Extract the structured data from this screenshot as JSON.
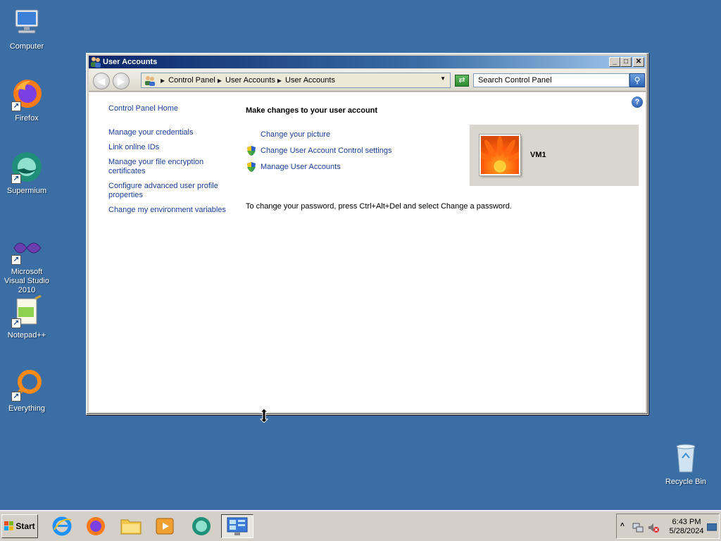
{
  "desktop": {
    "icons": [
      {
        "label": "Computer"
      },
      {
        "label": "Firefox"
      },
      {
        "label": "Supermium"
      },
      {
        "label": "Microsoft Visual Studio 2010"
      },
      {
        "label": "Notepad++"
      },
      {
        "label": "Everything"
      },
      {
        "label": "Recycle Bin"
      }
    ]
  },
  "window": {
    "title": "User Accounts",
    "buttons": {
      "minimize": "_",
      "maximize": "□",
      "close": "✕"
    },
    "address": {
      "crumbs": [
        "Control Panel",
        "User Accounts",
        "User Accounts"
      ]
    },
    "search": {
      "placeholder": "Search Control Panel"
    },
    "sidebar": {
      "home": "Control Panel Home",
      "links": [
        "Manage your credentials",
        "Link online IDs",
        "Manage your file encryption certificates",
        "Configure advanced user profile properties",
        "Change my environment variables"
      ]
    },
    "main": {
      "heading": "Make changes to your user account",
      "tasks": [
        {
          "label": "Change your picture",
          "icon": "none"
        },
        {
          "label": "Change User Account Control settings",
          "icon": "uac-shield-icon"
        },
        {
          "label": "Manage User Accounts",
          "icon": "uac-shield-icon"
        }
      ],
      "password_note": "To change your password, press Ctrl+Alt+Del and select Change a password.",
      "user": {
        "name": "VM1"
      }
    }
  },
  "taskbar": {
    "start_label": "Start",
    "apps": [
      "internet-explorer-icon",
      "firefox-icon",
      "file-explorer-icon",
      "media-player-icon",
      "supermium-icon",
      "control-panel-icon"
    ],
    "clock": {
      "time": "6:43 PM",
      "date": "5/28/2024"
    }
  },
  "colors": {
    "desktop": "#3a6ea5",
    "link": "#1a3e9a",
    "title_gradient_start": "#0a246a"
  }
}
